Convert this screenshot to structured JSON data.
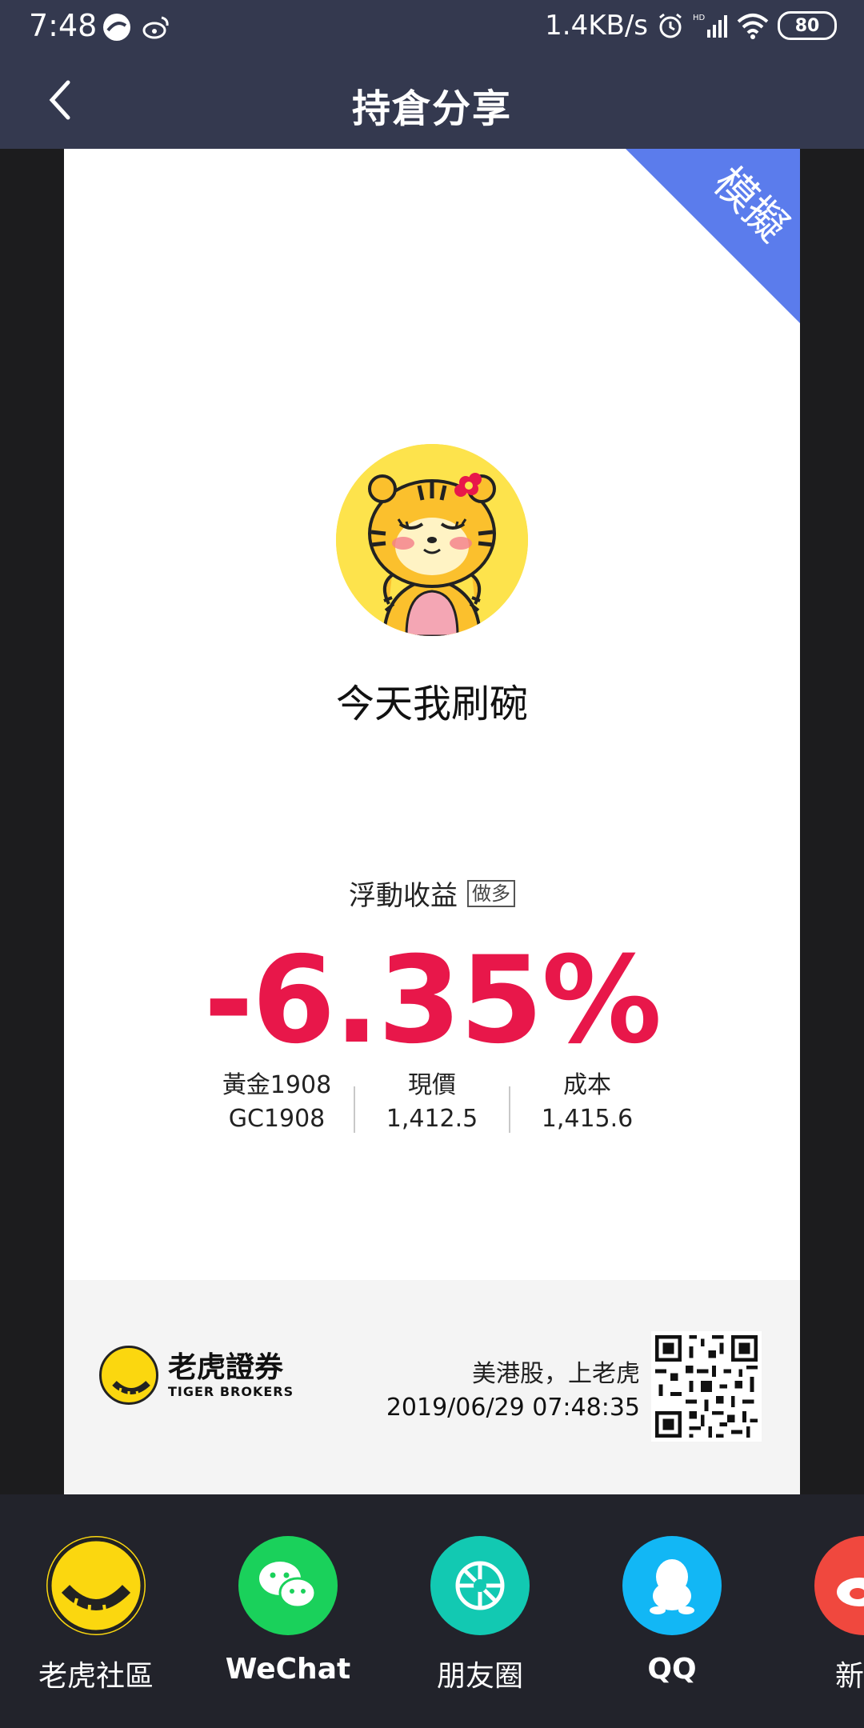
{
  "status_bar": {
    "time": "7:48",
    "net_speed": "1.4KB/s",
    "battery": "80"
  },
  "header": {
    "title": "持倉分享"
  },
  "card": {
    "ribbon_label": "模擬",
    "nickname": "今天我刷碗",
    "pl_label": "浮動收益",
    "direction_badge": "做多",
    "pl_percent": "-6.35%",
    "instrument_name": "黃金1908",
    "instrument_code": "GC1908",
    "price_label": "現價",
    "price_value": "1,412.5",
    "cost_label": "成本",
    "cost_value": "1,415.6"
  },
  "footer": {
    "brand_cn": "老虎證券",
    "brand_en": "TIGER BROKERS",
    "slogan": "美港股，上老虎",
    "timestamp": "2019/06/29 07:48:35"
  },
  "share": {
    "items": [
      {
        "label": "老虎社區",
        "icon": "tiger-community-icon",
        "color": "#fbd70f"
      },
      {
        "label": "WeChat",
        "icon": "wechat-icon",
        "color": "#1ad15b"
      },
      {
        "label": "朋友圈",
        "icon": "moments-icon",
        "color": "#12c9b2"
      },
      {
        "label": "QQ",
        "icon": "qq-icon",
        "color": "#12b7f5"
      },
      {
        "label": "新浪",
        "icon": "weibo-icon",
        "color": "#f0483e"
      }
    ]
  },
  "colors": {
    "header_bg": "#34394f",
    "ribbon": "#5b7cec",
    "loss_red": "#e8174a"
  }
}
